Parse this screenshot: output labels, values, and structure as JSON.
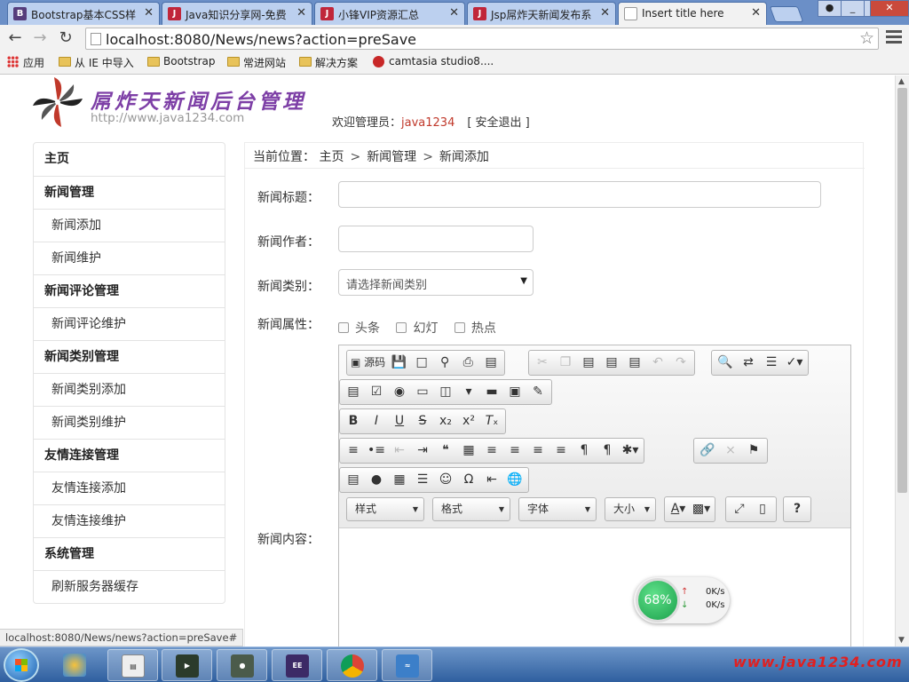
{
  "browser": {
    "tabs": [
      {
        "title": "Bootstrap基本CSS样",
        "icon": "bootstrap-favicon-icon"
      },
      {
        "title": "Java知识分享网-免费",
        "icon": "java-favicon-icon"
      },
      {
        "title": "小锋VIP资源汇总",
        "icon": "java-favicon-icon"
      },
      {
        "title": "Jsp屌炸天新闻发布系",
        "icon": "java-favicon-icon"
      },
      {
        "title": "Insert title here",
        "icon": "page-favicon-icon",
        "active": true
      }
    ],
    "url": "localhost:8080/News/news?action=preSave",
    "bookmarks": [
      "应用",
      "从 IE 中导入",
      "Bootstrap",
      "常进网站",
      "解决方案",
      "camtasia studio8...."
    ]
  },
  "header": {
    "title": "屌炸天新闻后台管理",
    "site_url": "http://www.java1234.com",
    "welcome_prefix": "欢迎管理员：",
    "username": "java1234",
    "logout": "[ 安全退出 ]"
  },
  "sidebar": {
    "items": [
      {
        "label": "主页",
        "type": "head"
      },
      {
        "label": "新闻管理",
        "type": "head"
      },
      {
        "label": "新闻添加",
        "type": "sub"
      },
      {
        "label": "新闻维护",
        "type": "sub"
      },
      {
        "label": "新闻评论管理",
        "type": "head"
      },
      {
        "label": "新闻评论维护",
        "type": "sub"
      },
      {
        "label": "新闻类别管理",
        "type": "head"
      },
      {
        "label": "新闻类别添加",
        "type": "sub"
      },
      {
        "label": "新闻类别维护",
        "type": "sub"
      },
      {
        "label": "友情连接管理",
        "type": "head"
      },
      {
        "label": "友情连接添加",
        "type": "sub"
      },
      {
        "label": "友情连接维护",
        "type": "sub"
      },
      {
        "label": "系统管理",
        "type": "head"
      },
      {
        "label": "刷新服务器缓存",
        "type": "sub"
      }
    ]
  },
  "breadcrumb": {
    "prefix": "当前位置：",
    "items": [
      "主页",
      "新闻管理",
      "新闻添加"
    ],
    "separator": ">"
  },
  "form": {
    "title_label": "新闻标题：",
    "title_value": "",
    "author_label": "新闻作者：",
    "author_value": "",
    "category_label": "新闻类别：",
    "category_selected": "请选择新闻类别",
    "attributes_label": "新闻属性：",
    "attributes": [
      {
        "label": "头条",
        "checked": false
      },
      {
        "label": "幻灯",
        "checked": false
      },
      {
        "label": "热点",
        "checked": false
      }
    ],
    "content_label": "新闻内容："
  },
  "editor": {
    "source_label": "源码",
    "dropdowns": [
      "样式",
      "格式",
      "字体",
      "大小"
    ]
  },
  "net_monitor": {
    "percent": "68%",
    "upload": "0K/s",
    "download": "0K/s"
  },
  "status_bar": "localhost:8080/News/news?action=preSave#",
  "taskbar": {
    "watermark": "www.java1234.com"
  },
  "colors": {
    "title_purple": "#7d3fa6",
    "username_red": "#c0392b",
    "tab_blue": "#6b8fc7"
  }
}
